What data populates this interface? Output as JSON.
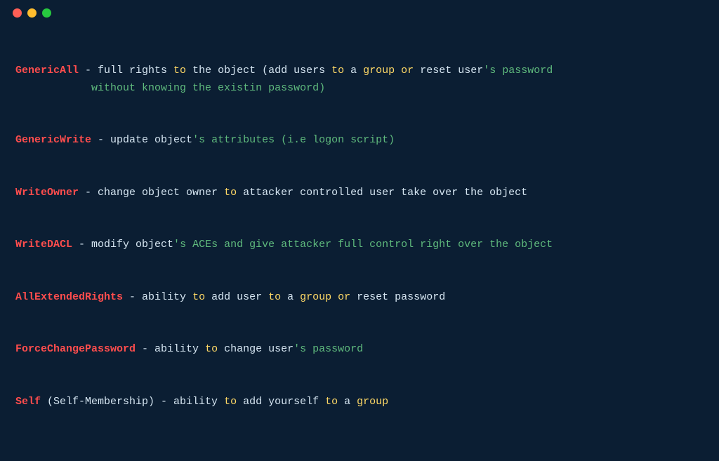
{
  "traffic": {
    "red": "close",
    "yellow": "minimize",
    "green": "zoom"
  },
  "entries": [
    {
      "name": "GenericAll",
      "pre": " - full rights ",
      "to1": "to",
      "mid1": " the object (add users ",
      "to2": "to",
      "mid2": " a ",
      "grp": "group",
      "mid3": " ",
      "or": "or",
      "mid4": " reset user",
      "apos": "'",
      "tail": "s password",
      "cont": "            without knowing the existin password)"
    },
    {
      "name": "GenericWrite",
      "pre": " - update object",
      "apos": "'",
      "tail": "s attributes (i.e logon script)"
    },
    {
      "name": "WriteOwner",
      "pre": " - change object owner ",
      "to1": "to",
      "mid1": " attacker controlled user take over the object"
    },
    {
      "name": "WriteDACL",
      "pre": " - modify object",
      "apos": "'",
      "tail": "s ACEs and give attacker full control right over the object"
    },
    {
      "name": "AllExtendedRights",
      "pre": " - ability ",
      "to1": "to",
      "mid1": " add user ",
      "to2": "to",
      "mid2": " a ",
      "grp": "group",
      "mid3": " ",
      "or": "or",
      "mid4": " reset password"
    },
    {
      "name": "ForceChangePassword",
      "pre": " - ability ",
      "to1": "to",
      "mid1": " change user",
      "apos": "'",
      "tail": "s password"
    },
    {
      "name": "Self",
      "paren": " (Self-Membership) - ability ",
      "to1": "to",
      "mid1": " add yourself ",
      "to2": "to",
      "mid2": " a ",
      "grp": "group"
    }
  ]
}
